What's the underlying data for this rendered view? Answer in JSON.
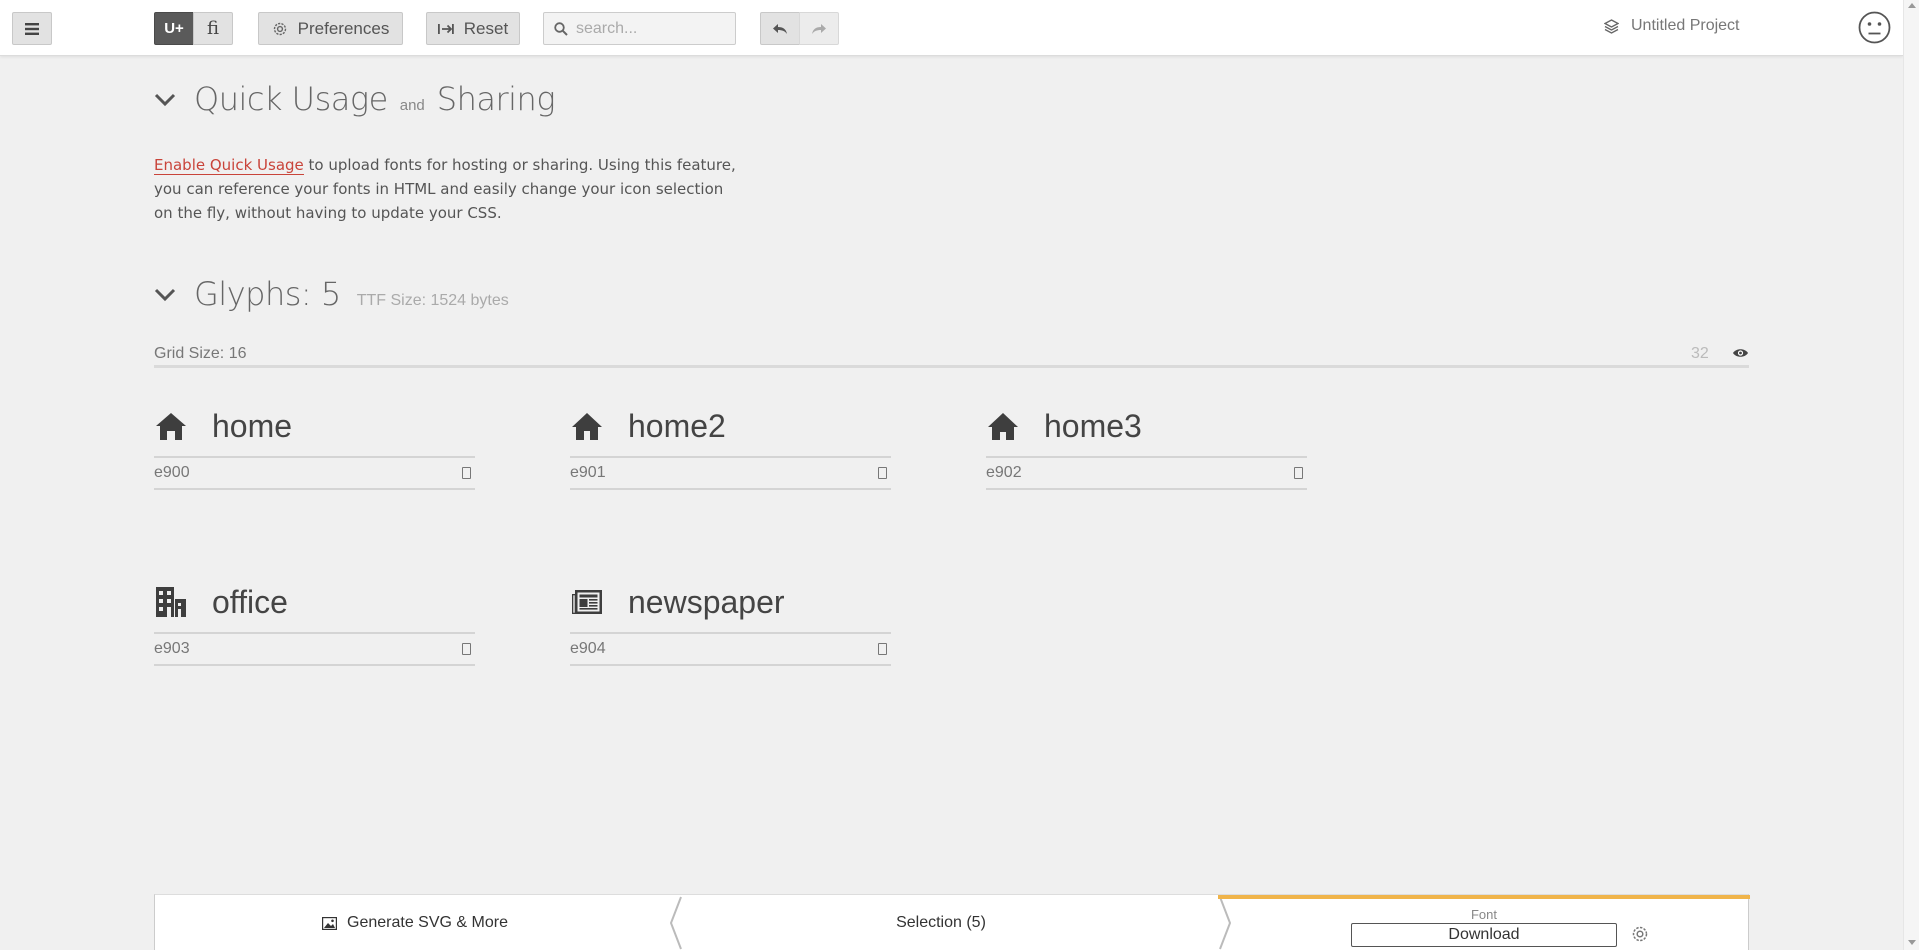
{
  "toolbar": {
    "menu_icon": "hamburger-icon",
    "unicode_label": "U+",
    "ligature_label": "ﬁ",
    "preferences_label": "Preferences",
    "reset_label": "Reset",
    "search_placeholder": "search...",
    "project_name": "Untitled Project"
  },
  "quick_usage": {
    "title_part1": "Quick Usage",
    "title_and": "and",
    "title_part2": "Sharing",
    "link_text": "Enable Quick Usage",
    "description": " to upload fonts for hosting or sharing. Using this feature, you can reference your fonts in HTML and easily change your icon selection on the fly, without having to update your CSS."
  },
  "glyphs_section": {
    "title": "Glyphs: 5",
    "ttf_size": "TTF Size: 1524 bytes",
    "grid_size_label": "Grid Size: 16",
    "grid_size_value": "32"
  },
  "glyphs": [
    {
      "name": "home",
      "code": "e900",
      "icon": "home-icon"
    },
    {
      "name": "home2",
      "code": "e901",
      "icon": "home2-icon"
    },
    {
      "name": "home3",
      "code": "e902",
      "icon": "home3-icon"
    },
    {
      "name": "office",
      "code": "e903",
      "icon": "office-icon"
    },
    {
      "name": "newspaper",
      "code": "e904",
      "icon": "newspaper-icon"
    }
  ],
  "bottom_bar": {
    "generate_label": "Generate SVG & More",
    "selection_label": "Selection (5)",
    "font_label": "Font",
    "download_label": "Download"
  },
  "colors": {
    "accent_link": "#c9443a",
    "font_tab_accent": "#f0b44a",
    "active_segment": "#5a5a5a"
  }
}
